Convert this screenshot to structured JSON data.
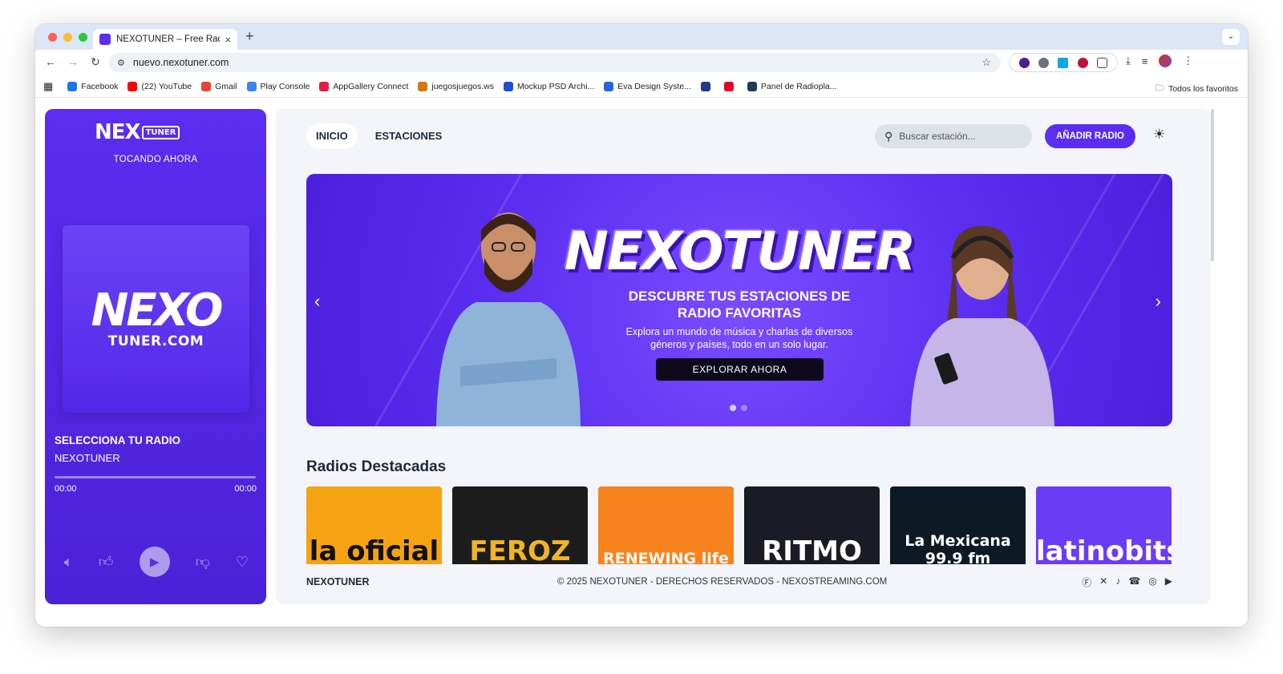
{
  "browser": {
    "tab_title": "NEXOTUNER – Free Radio Lis",
    "tab_close": "×",
    "new_tab": "+",
    "url": "nuevo.nexotuner.com",
    "bookmarks": [
      {
        "label": "Facebook",
        "color": "#1877f2"
      },
      {
        "label": "(22) YouTube",
        "color": "#ff0000"
      },
      {
        "label": "Gmail",
        "color": "#ea4335"
      },
      {
        "label": "Play Console",
        "color": "#3b82f6"
      },
      {
        "label": "AppGallery Connect",
        "color": "#e11d48"
      },
      {
        "label": "juegosjuegos.ws",
        "color": "#d97706"
      },
      {
        "label": "Mockup PSD Archi...",
        "color": "#1d4ed8"
      },
      {
        "label": "Eva Design Syste...",
        "color": "#2563eb"
      },
      {
        "label": "",
        "color": "#1e3a8a"
      },
      {
        "label": "",
        "color": "#e60023"
      },
      {
        "label": "Panel de Radiopla...",
        "color": "#1e3a5f"
      }
    ],
    "all_bookmarks": "Todos los favoritos"
  },
  "player": {
    "logo_main": "NEX",
    "logo_tag": "TUNER",
    "now_playing": "TOCANDO AHORA",
    "art_big": "NEXO",
    "art_small": "TUNER.COM",
    "station": "SELECCIONA TU RADIO",
    "artist": "NEXOTUNER",
    "time_current": "00:00",
    "time_total": "00:00",
    "progress": 0
  },
  "header": {
    "nav": [
      "INICIO",
      "ESTACIONES"
    ],
    "search_placeholder": "Buscar estación...",
    "add_button": "AÑADIR RADIO"
  },
  "banner": {
    "headline": "NEXOTUNER",
    "subtitle_line1": "DESCUBRE TUS ESTACIONES DE",
    "subtitle_line2": "RADIO FAVORITAS",
    "desc_line1": "Explora un mundo de música y charlas de diversos",
    "desc_line2": "géneros y países, todo en un solo lugar.",
    "cta": "EXPLORAR AHORA",
    "slides": 2,
    "active_slide": 0
  },
  "featured": {
    "title": "Radios Destacadas",
    "stations": [
      {
        "label": "la oficial",
        "bg": "#f6a313",
        "fg": "#111111"
      },
      {
        "label": "FEROZ",
        "bg": "#1c1c1c",
        "fg": "#f0b429"
      },
      {
        "label": "RENEWING life",
        "bg": "#f7831f",
        "fg": "#ffffff"
      },
      {
        "label": "RITMO",
        "bg": "#1b1b25",
        "fg": "#ffffff"
      },
      {
        "label": "La Mexicana 99.9 fm",
        "bg": "#0b1a24",
        "fg": "#ffffff"
      },
      {
        "label": "latinobits",
        "bg": "#6b3cf5",
        "fg": "#ffffff"
      }
    ]
  },
  "footer": {
    "brand": "NEXOTUNER",
    "copyright": "© 2025 NEXOTUNER - DERECHOS RESERVADOS - NEXOSTREAMING.COM"
  },
  "colors": {
    "accent": "#5a2df0",
    "sidebar": "#4a22d6"
  }
}
